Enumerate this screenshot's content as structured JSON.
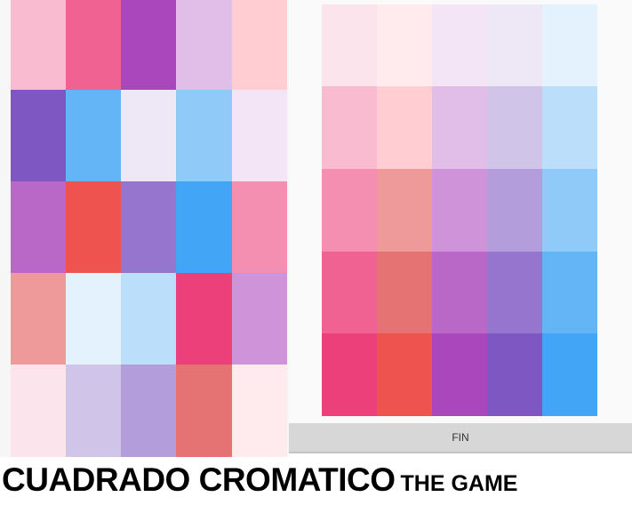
{
  "left_board": {
    "rows": [
      [
        "#f8bbd0",
        "#f06292",
        "#ab47bc",
        "#e1bee7",
        "#ffcdd2"
      ],
      [
        "#7e57c2",
        "#64b5f6",
        "#ede7f6",
        "#90caf9",
        "#f3e5f5"
      ],
      [
        "#ba68c8",
        "#ef5350",
        "#9575cd",
        "#42a5f5",
        "#f48fb1"
      ],
      [
        "#ef9a9a",
        "#e3f2fd",
        "#bbdefb",
        "#ec407a",
        "#ce93d8"
      ],
      [
        "#fce4ec",
        "#d1c4e9",
        "#b39ddb",
        "#e57373",
        "#ffebee"
      ]
    ]
  },
  "right_board": {
    "rows": [
      [
        "#fce4ec",
        "#ffebee",
        "#f3e5f5",
        "#ede7f6",
        "#e3f2fd"
      ],
      [
        "#f8bbd0",
        "#ffcdd2",
        "#e1bee7",
        "#d1c4e9",
        "#bbdefb"
      ],
      [
        "#f48fb1",
        "#ef9a9a",
        "#ce93d8",
        "#b39ddb",
        "#90caf9"
      ],
      [
        "#f06292",
        "#e57373",
        "#ba68c8",
        "#9575cd",
        "#64b5f6"
      ],
      [
        "#ec407a",
        "#ef5350",
        "#ab47bc",
        "#7e57c2",
        "#42a5f5"
      ]
    ]
  },
  "fin_button": {
    "label": "FIN"
  },
  "title": {
    "main": "CUADRADO CROMATICO",
    "sub": "THE GAME"
  }
}
